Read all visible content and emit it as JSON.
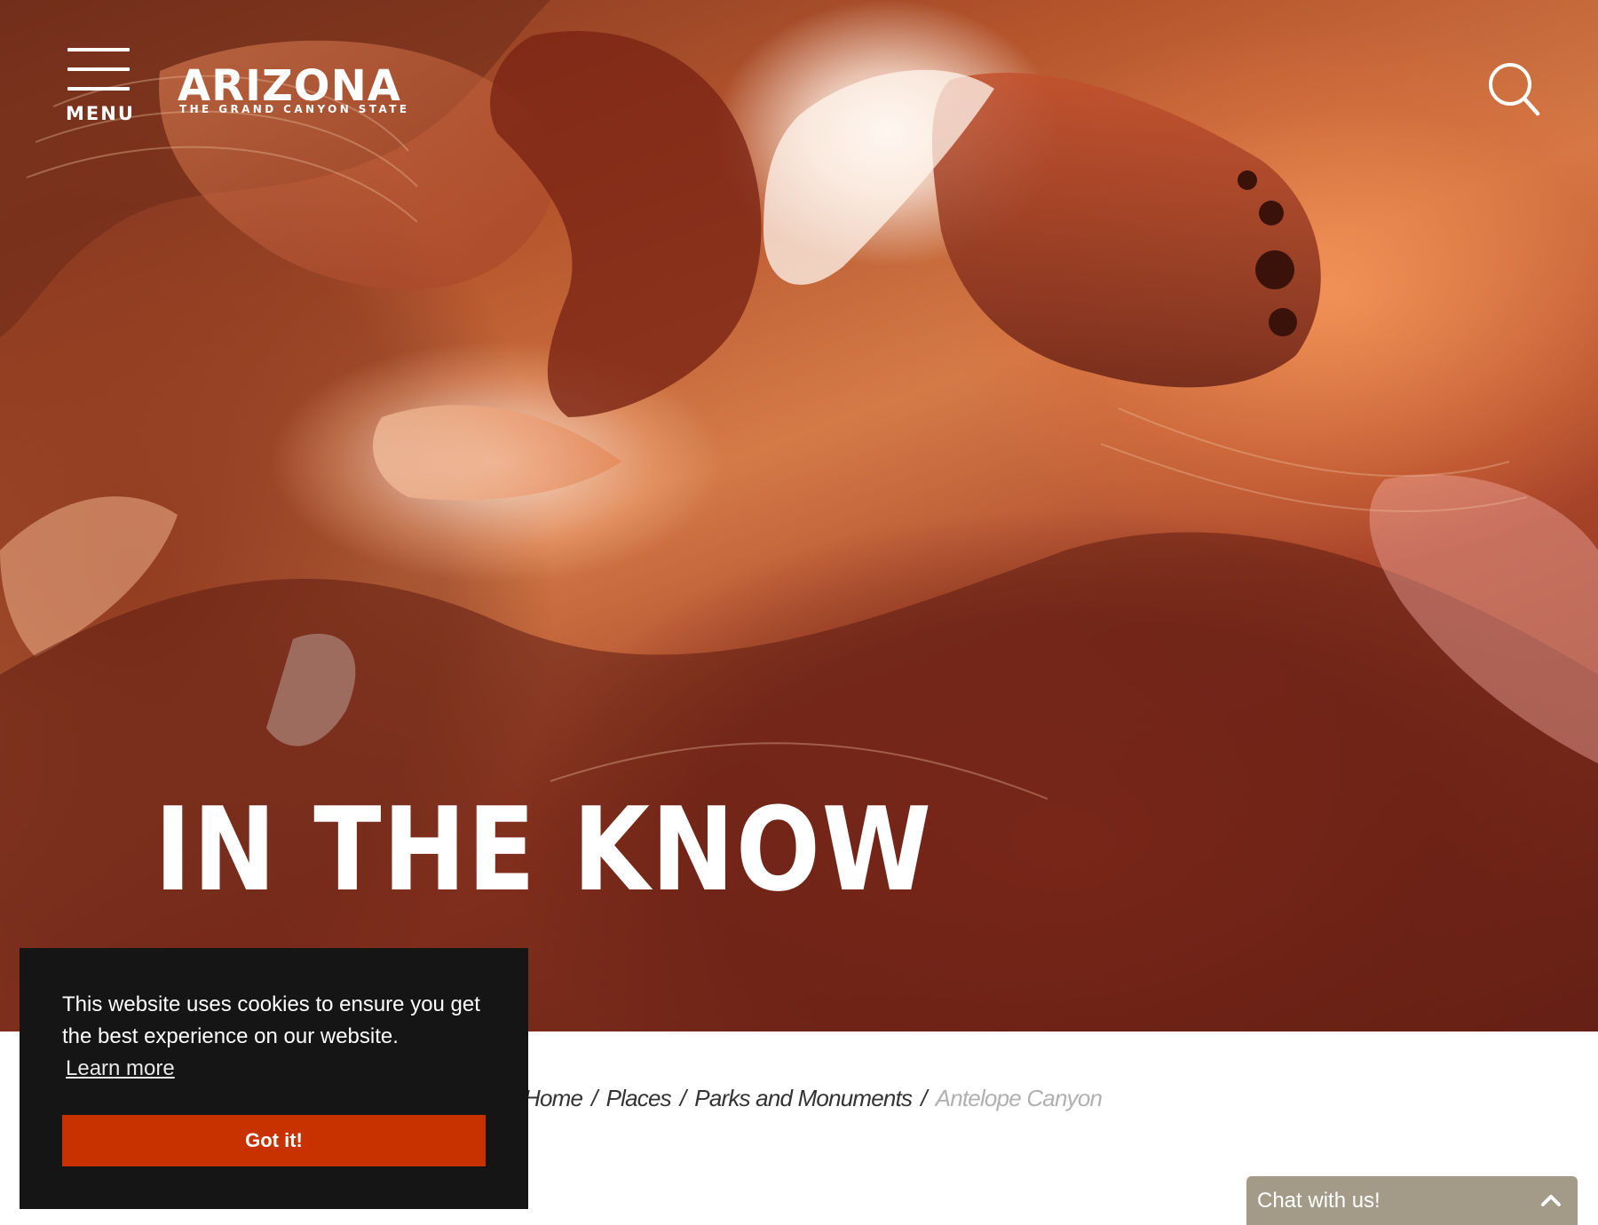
{
  "header": {
    "menu_label": "MENU",
    "logo_word": "ARIZONA",
    "logo_tagline": "THE GRAND CANYON STATE",
    "icons": {
      "menu": "hamburger-icon",
      "search": "search-icon"
    }
  },
  "hero": {
    "title": "IN THE KNOW"
  },
  "breadcrumb": {
    "items": [
      "Home",
      "Places",
      "Parks and Monuments"
    ],
    "separator": "/",
    "current": "Antelope Canyon"
  },
  "cookie_banner": {
    "message": "This website uses cookies to ensure you get the best experience on our website.",
    "learn_more": "Learn more",
    "accept_label": "Got it!",
    "accept_color": "#c83200",
    "background": "#151515"
  },
  "chat": {
    "label": "Chat with us!",
    "icon": "chevron-up-icon",
    "background": "#a39a87"
  }
}
